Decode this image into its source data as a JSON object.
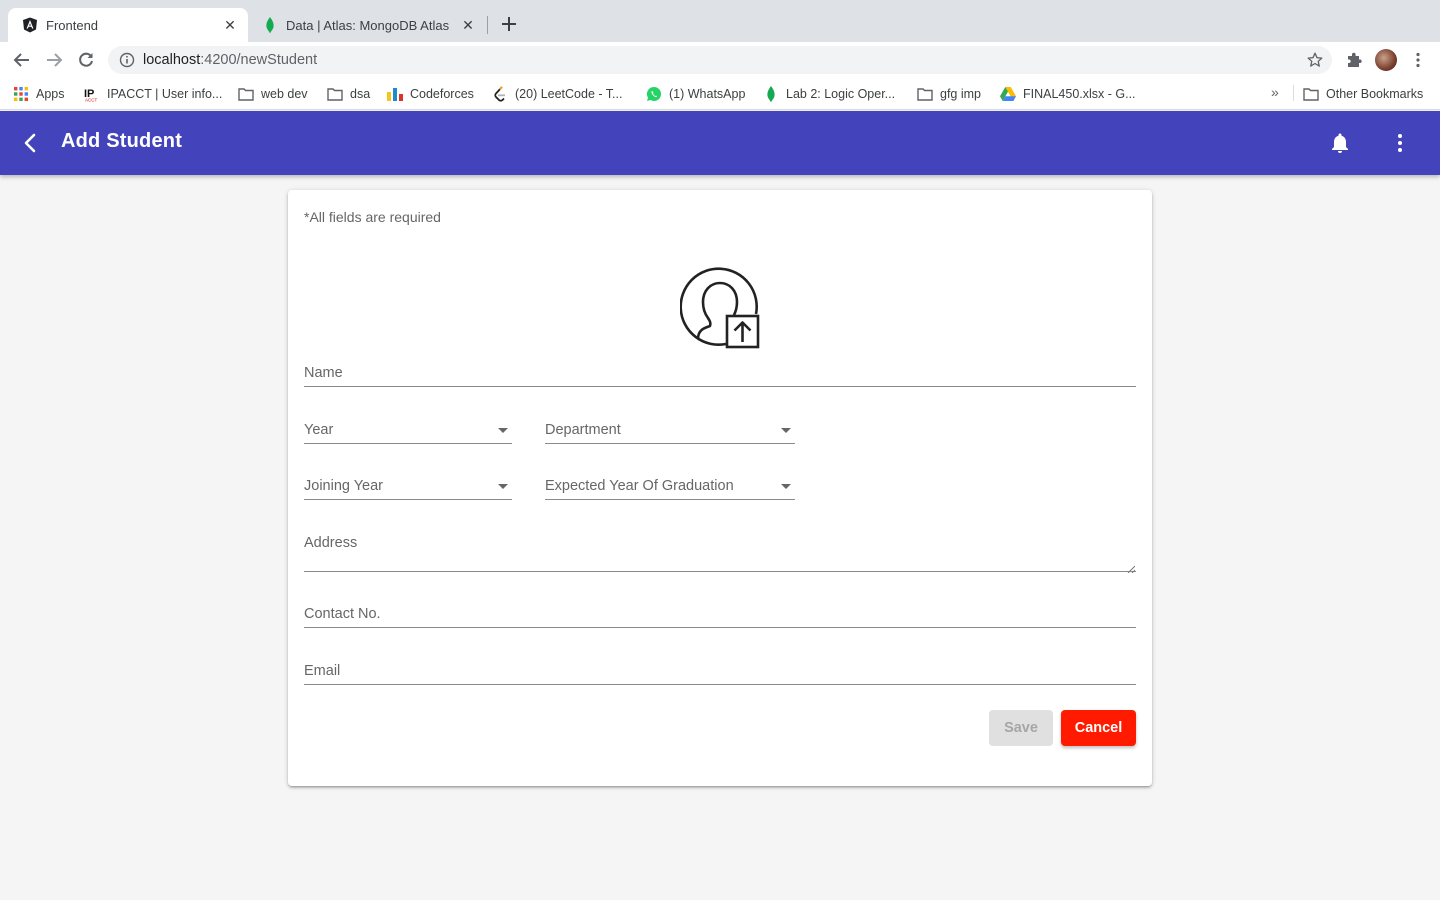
{
  "browser": {
    "tabs": [
      {
        "title": "Frontend",
        "active": true,
        "icon": "angular-icon"
      },
      {
        "title": "Data | Atlas: MongoDB Atlas",
        "active": false,
        "icon": "mongodb-leaf-icon"
      }
    ],
    "url_host": "localhost",
    "url_path": ":4200/newStudent",
    "bookmarks": [
      {
        "label": "Apps",
        "icon": "apps-grid-icon"
      },
      {
        "label": "IPACCT | User info...",
        "icon": "ipacct-icon"
      },
      {
        "label": "web dev",
        "icon": "folder-icon"
      },
      {
        "label": "dsa",
        "icon": "folder-icon"
      },
      {
        "label": "Codeforces",
        "icon": "codeforces-icon"
      },
      {
        "label": "(20) LeetCode - T...",
        "icon": "leetcode-icon"
      },
      {
        "label": "(1) WhatsApp",
        "icon": "whatsapp-icon"
      },
      {
        "label": "Lab 2: Logic Oper...",
        "icon": "mongodb-leaf-icon"
      },
      {
        "label": "gfg imp",
        "icon": "folder-icon"
      },
      {
        "label": "FINAL450.xlsx - G...",
        "icon": "google-drive-icon"
      }
    ],
    "overflow": "»",
    "other_bookmarks": "Other Bookmarks"
  },
  "app": {
    "title": "Add Student",
    "accent_color": "#4343bc"
  },
  "form": {
    "required_note": "*All fields are required",
    "name_label": "Name",
    "year_label": "Year",
    "department_label": "Department",
    "joining_year_label": "Joining Year",
    "graduation_label": "Expected Year Of Graduation",
    "address_label": "Address",
    "contact_label": "Contact No.",
    "email_label": "Email",
    "save_label": "Save",
    "cancel_label": "Cancel",
    "cancel_color": "#ff1a00"
  }
}
